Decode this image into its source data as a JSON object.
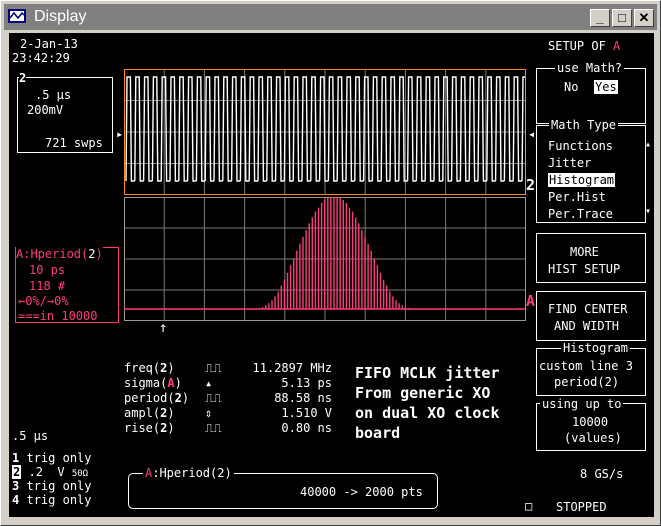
{
  "window": {
    "title": "Display"
  },
  "titlebar_buttons": {
    "minimize": "_",
    "maximize": "□",
    "close": "✕"
  },
  "header": {
    "date": "2-Jan-13",
    "time": "23:42:29",
    "setup_label": "SETUP OF",
    "setup_trace": "A"
  },
  "channel_box": {
    "number": "2",
    "timebase": ".5 μs",
    "volts": "200mV",
    "sweeps": "721 swps"
  },
  "trace_markers": {
    "upper": "2",
    "lower": "A"
  },
  "hist_box": {
    "trace": "A",
    "param": ":Hperiod(",
    "param_ch": "2",
    "param_end": ")",
    "width": "10 ps",
    "bins": "118 #",
    "overflow": "←0%/→0%",
    "count": "===in 10000"
  },
  "menu": {
    "use_math": {
      "title": "use Math?",
      "no": "No",
      "yes": "Yes"
    },
    "math_type": {
      "title": "Math Type",
      "items": [
        "Functions",
        "Jitter",
        "Histogram",
        "Per.Hist",
        "Per.Trace"
      ]
    },
    "more_hist": {
      "line1": "MORE",
      "line2": "HIST SETUP"
    },
    "find_center": {
      "line1": "FIND CENTER",
      "line2": "AND WIDTH"
    },
    "histogram": {
      "title": "Histogram",
      "line1": "custom line 3",
      "line2": "period(",
      "line2_ch": "2",
      "line2_end": ")"
    },
    "using": {
      "title": "using up to",
      "value": "10000",
      "unit": "(values)"
    }
  },
  "measurements": [
    {
      "name": "freq(",
      "ch": "2",
      "end": ")",
      "icon": "⎍⎍",
      "value": "11.2897 MHz"
    },
    {
      "name": "sigma(",
      "ch": "A",
      "end": ")",
      "icon": "▴",
      "value": "5.13 ps"
    },
    {
      "name": "period(",
      "ch": "2",
      "end": ")",
      "icon": "⎍⎍",
      "value": "88.58 ns"
    },
    {
      "name": "ampl(",
      "ch": "2",
      "end": ")",
      "icon": "⇕",
      "value": "1.510 V"
    },
    {
      "name": "rise(",
      "ch": "2",
      "end": ")",
      "icon": "⎍⎍",
      "value": "0.80 ns"
    }
  ],
  "annotation": [
    "FIFO MCLK jitter",
    "From generic XO",
    "on dual XO clock",
    "board"
  ],
  "footer": {
    "timebase": ".5 μs",
    "ch1": {
      "num": "1",
      "text": "trig only"
    },
    "ch2": {
      "num": "2",
      "text": ".2  V",
      "imp": "50Ω"
    },
    "ch3": {
      "num": "3",
      "text": "trig only"
    },
    "ch4": {
      "num": "4",
      "text": "trig only"
    },
    "sample_rate": "8 GS/s",
    "status": "STOPPED"
  },
  "bottom_box": {
    "trace": "A",
    "label": ":Hperiod(",
    "ch": "2",
    "end": ")",
    "value": "40000 -> 2000 pts"
  },
  "histogram_bins": [
    1,
    2,
    4,
    6,
    9,
    13,
    18,
    24,
    30,
    37,
    45,
    52,
    60,
    67,
    74,
    81,
    88,
    94,
    100,
    104,
    109,
    112,
    114,
    116,
    117,
    116,
    114,
    112,
    109,
    104,
    100,
    94,
    88,
    81,
    74,
    67,
    60,
    52,
    45,
    37,
    30,
    24,
    18,
    13,
    9,
    6,
    4,
    2,
    1
  ],
  "colors": {
    "accent": "#ff3b7a",
    "waveform_border": "#ff8c1a",
    "grid": "#7a7a7a"
  }
}
